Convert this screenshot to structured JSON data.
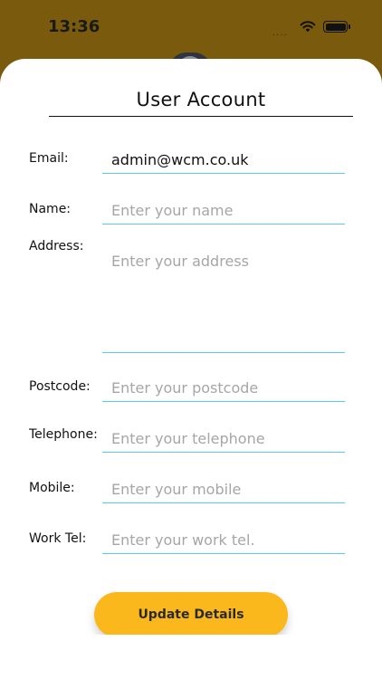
{
  "status_bar": {
    "time": "13:36",
    "dots": "...."
  },
  "title": "User Account",
  "fields": {
    "email": {
      "label": "Email:",
      "value": "admin@wcm.co.uk",
      "placeholder": ""
    },
    "name": {
      "label": "Name:",
      "value": "",
      "placeholder": "Enter your name"
    },
    "address": {
      "label": "Address:",
      "value": "",
      "placeholder": "Enter your address"
    },
    "postcode": {
      "label": "Postcode:",
      "value": "",
      "placeholder": "Enter your postcode"
    },
    "telephone": {
      "label": "Telephone:",
      "value": "",
      "placeholder": "Enter your telephone"
    },
    "mobile": {
      "label": "Mobile:",
      "value": "",
      "placeholder": "Enter your mobile"
    },
    "work_tel": {
      "label": "Work Tel:",
      "value": "",
      "placeholder": "Enter your work tel."
    }
  },
  "update_button": {
    "label": "Update Details"
  },
  "colors": {
    "header_background": "#7a5a0c",
    "accent_underline": "#5ac8fa",
    "button": "#fbb81c"
  },
  "icons": [
    "wifi-icon",
    "battery-icon"
  ]
}
